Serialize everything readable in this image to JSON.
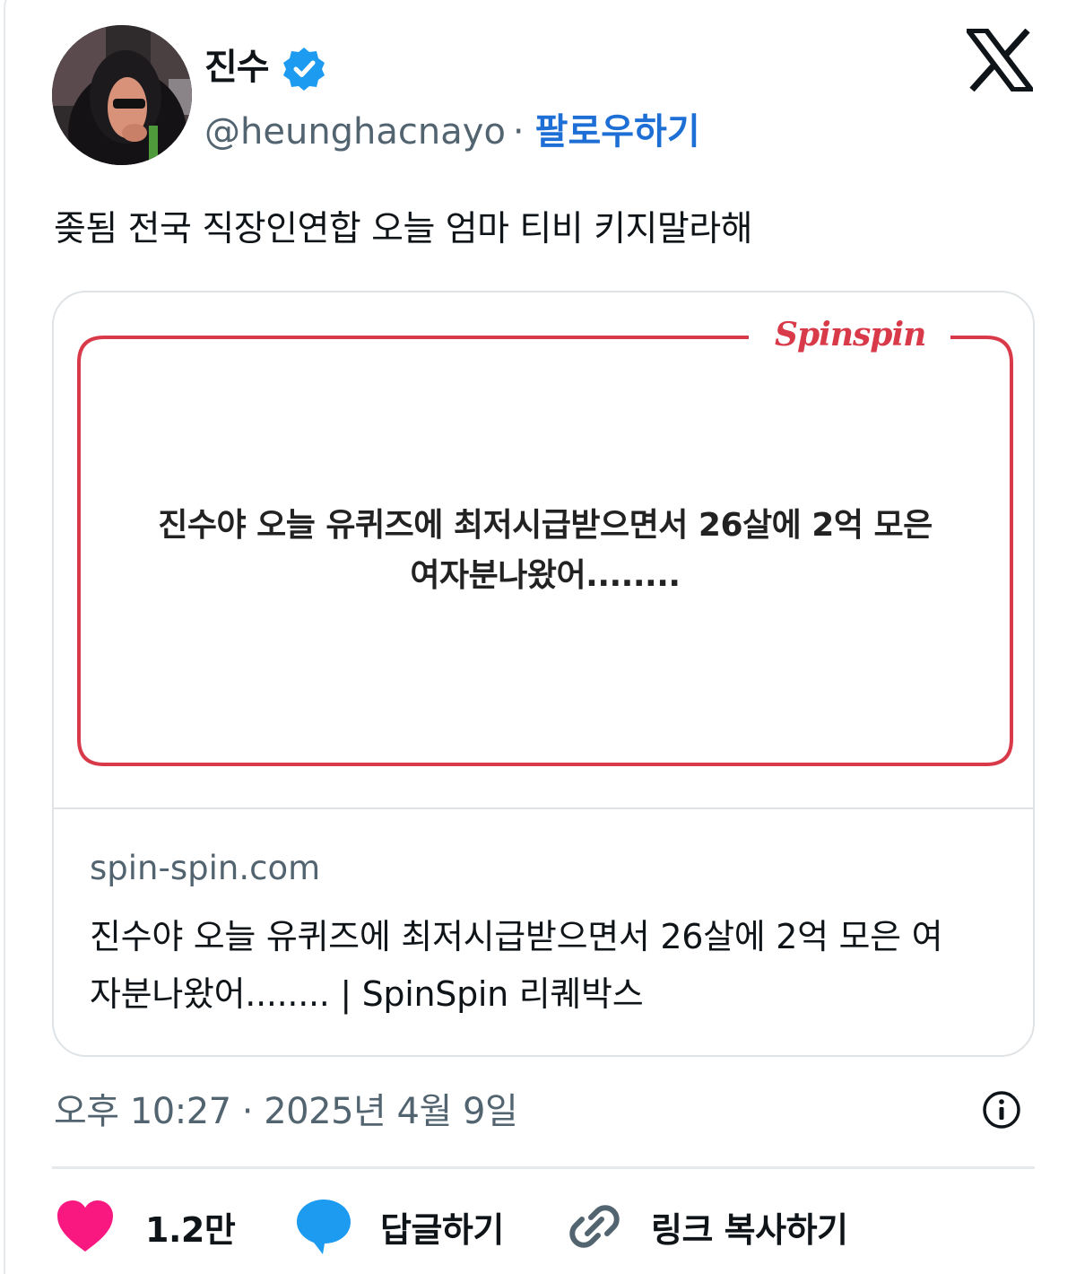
{
  "author": {
    "display_name": "진수",
    "handle": "@heunghacnayo",
    "separator": "·",
    "follow_label": "팔로우하기",
    "verified": true
  },
  "tweet": {
    "text": "좆됨 전국 직장인연합 오늘 엄마 티비 키지말라해",
    "timestamp": "오후 10:27 · 2025년 4월 9일"
  },
  "link_card": {
    "brand_logo": "Spinspin",
    "image_headline_line1": "진수야 오늘 유퀴즈에 최저시급받으면서 26살에 2억 모은",
    "image_headline_line2": "여자분나왔어........",
    "domain": "spin-spin.com",
    "title_line1": "진수야 오늘 유퀴즈에 최저시급받으면서 26살에 2억 모은 여",
    "title_line2": "자분나왔어........ | SpinSpin 리퀘박스"
  },
  "actions": {
    "like_count": "1.2만",
    "reply_label": "답글하기",
    "copy_link_label": "링크 복사하기"
  },
  "colors": {
    "accent": "#1d9bf0",
    "follow": "#1d6fd6",
    "like": "#f91880",
    "brand_red": "#d93a4a",
    "muted_text": "#536471"
  },
  "icons": [
    "verified-badge-icon",
    "x-logo-icon",
    "info-icon",
    "heart-icon",
    "reply-bubble-icon",
    "link-icon"
  ]
}
